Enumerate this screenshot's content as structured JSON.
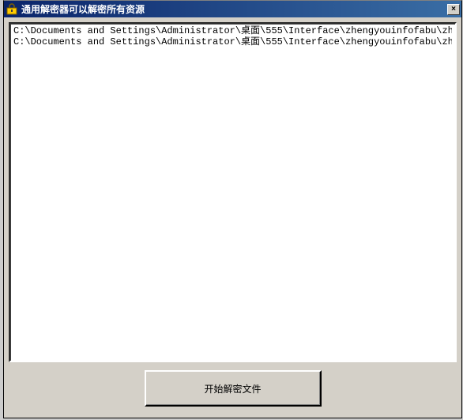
{
  "window": {
    "title": "通用解密器可以解密所有资源"
  },
  "textPanel": {
    "lines": [
      "C:\\Documents and Settings\\Administrator\\桌面\\555\\Interface\\zhengyouinfofabu\\zhengyouinfofabu.",
      "C:\\Documents and Settings\\Administrator\\桌面\\555\\Interface\\zhengyouinfofabu\\zhengyouinfofabu."
    ]
  },
  "buttons": {
    "decrypt_label": "开始解密文件",
    "close_label": "×"
  }
}
